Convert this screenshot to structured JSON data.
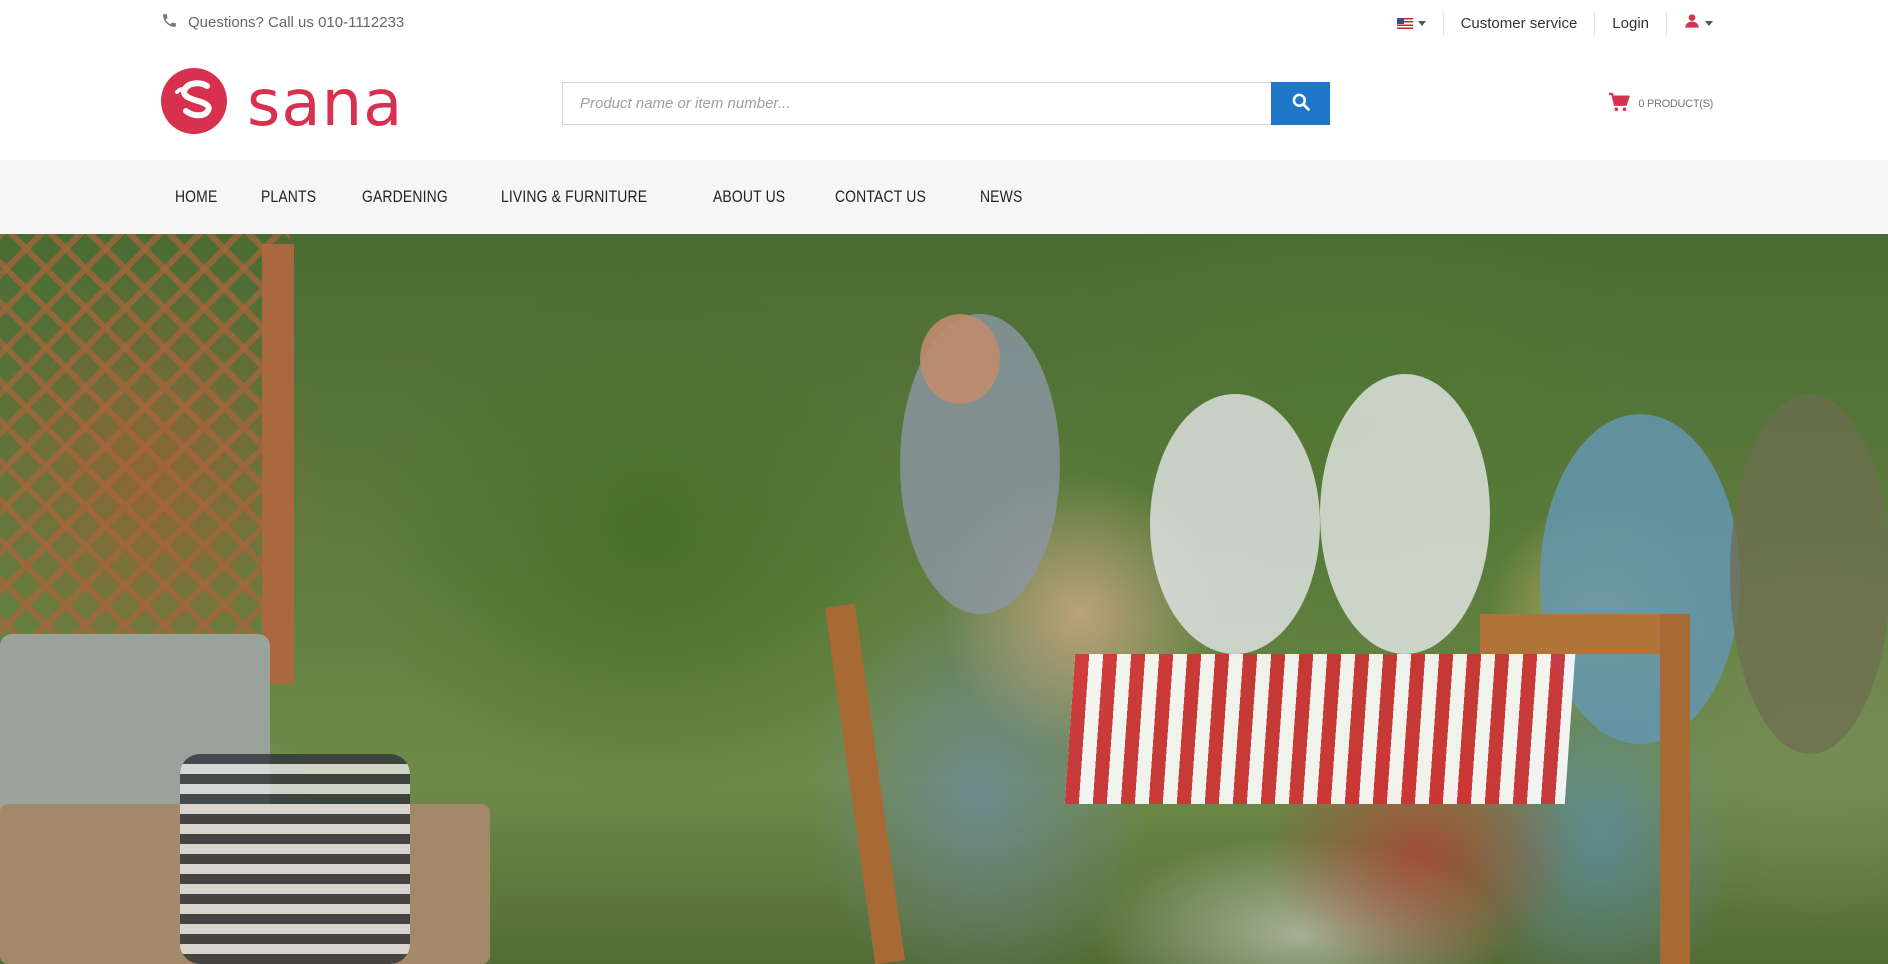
{
  "topbar": {
    "phone_text": "Questions? Call us 010-1112233",
    "language_flag": "us-flag-icon",
    "customer_service": "Customer service",
    "login": "Login",
    "account_icon": "user-icon"
  },
  "header": {
    "logo_text": "sana",
    "search_placeholder": "Product name or item number...",
    "cart_label": "0 PRODUCT(S)"
  },
  "nav": {
    "items": [
      "HOME",
      "PLANTS",
      "GARDENING",
      "LIVING & FURNITURE",
      "ABOUT US",
      "CONTACT US",
      "NEWS"
    ]
  },
  "colors": {
    "brand": "#d8304f",
    "search_button": "#1f77c9",
    "nav_background": "#f6f6f6"
  }
}
